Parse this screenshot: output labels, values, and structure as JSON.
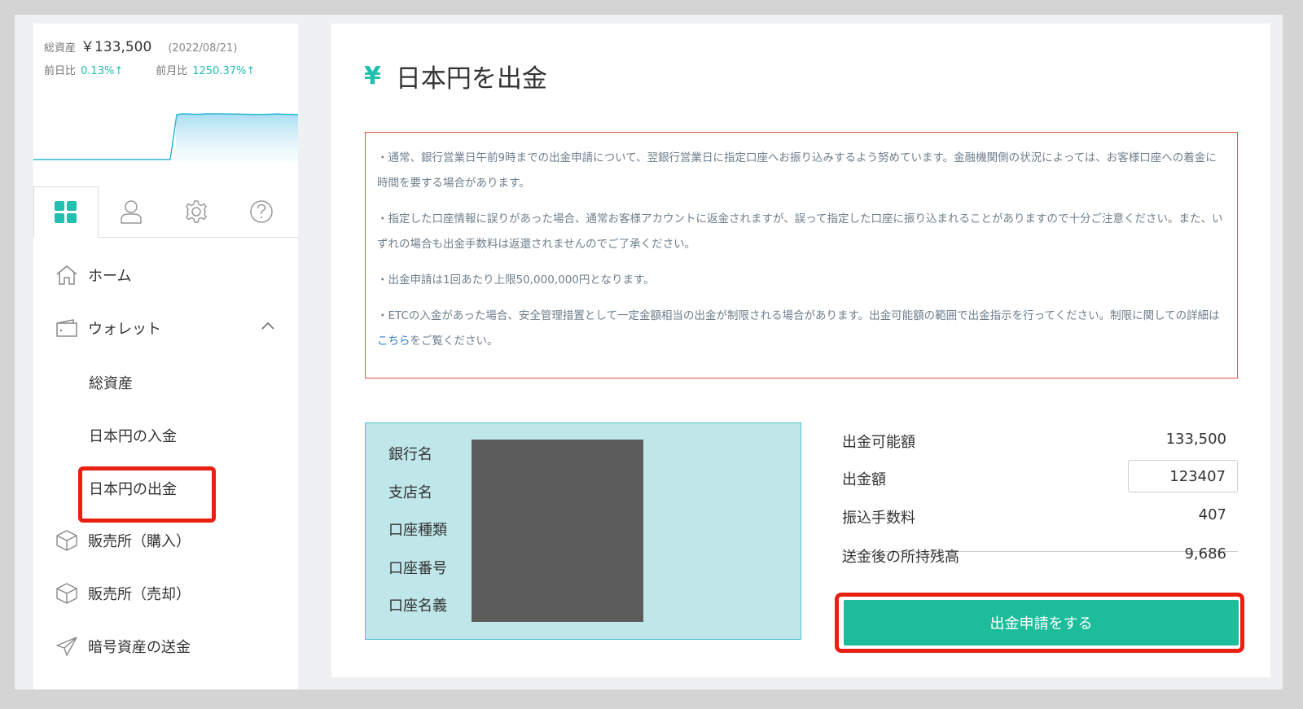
{
  "summary": {
    "total_label": "総資産",
    "total_amount": "￥133,500",
    "date": "(2022/08/21)",
    "day_label": "前日比",
    "day_pct": "0.13%↑",
    "month_label": "前月比",
    "month_pct": "1250.37%↑"
  },
  "icon_tabs": [
    "dashboard-grid-icon",
    "user-icon",
    "gear-icon",
    "help-icon"
  ],
  "nav": {
    "home": "ホーム",
    "wallet": "ウォレット",
    "sub": {
      "total_assets": "総資産",
      "jpy_deposit": "日本円の入金",
      "jpy_withdraw": "日本円の出金"
    },
    "buy": "販売所（購入）",
    "sell": "販売所（売却）",
    "crypto_send": "暗号資産の送金"
  },
  "page": {
    "title_icon": "¥",
    "title": "日本円を出金"
  },
  "notice": {
    "p1": "・通常、銀行営業日午前9時までの出金申請について、翌銀行営業日に指定口座へお振り込みするよう努めています。金融機関側の状況によっては、お客様口座への着金に時間を要する場合があります。",
    "p2": "・指定した口座情報に誤りがあった場合、通常お客様アカウントに返金されますが、誤って指定した口座に振り込まれることがありますので十分ご注意ください。また、いずれの場合も出金手数料は返還されませんのでご了承ください。",
    "p3": "・出金申請は1回あたり上限50,000,000円となります。",
    "p4_before": "・ETCの入金があった場合、安全管理措置として一定金額相当の出金が制限される場合があります。出金可能額の範囲で出金指示を行ってください。制限に関しての詳細は",
    "p4_link": "こちら",
    "p4_after": "をご覧ください。"
  },
  "bank": {
    "bank_name": "銀行名",
    "branch": "支店名",
    "account_type": "口座種類",
    "account_number": "口座番号",
    "account_holder": "口座名義"
  },
  "amounts": {
    "available_label": "出金可能額",
    "available_value": "133,500",
    "amount_label": "出金額",
    "amount_value": "123407",
    "fee_label": "振込手数料",
    "fee_value": "407",
    "balance_label": "送金後の所持残高",
    "balance_value": "9,686"
  },
  "submit_label": "出金申請をする",
  "colors": {
    "accent": "#21c0b0",
    "button": "#1dbd9c",
    "highlight": "#e8200f",
    "notice_border": "#e8533a",
    "bank_bg": "#bfe6e8"
  }
}
